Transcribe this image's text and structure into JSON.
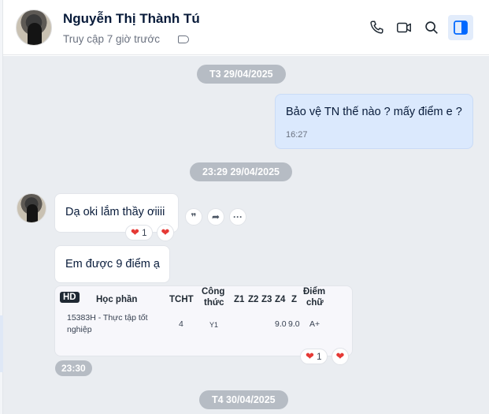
{
  "header": {
    "contact_name": "Nguyễn Thị Thành Tú",
    "status": "Truy cập 7 giờ trước",
    "icons": [
      "phone-icon",
      "video-call-icon",
      "search-icon",
      "side-panel-icon"
    ],
    "accent_color": "#0068ff"
  },
  "chat": {
    "date_separators": [
      "T3 29/04/2025",
      "23:29 29/04/2025",
      "T4 30/04/2025"
    ],
    "outgoing_message": {
      "text": "Bảo vệ TN thế nào ? mấy điểm e ?",
      "time": "16:27"
    },
    "incoming_message_1": {
      "text": "Dạ oki lắm thầy ơiiii",
      "reaction_count": "1"
    },
    "message_actions": {
      "quote": "❞",
      "forward": "➦",
      "more": "···"
    },
    "incoming_message_2": {
      "text": "Em được 9 điểm ạ"
    },
    "grade_card": {
      "badge": "HD",
      "headers": {
        "course": "Học phần",
        "credits": "TCHT",
        "formula_1": "Công",
        "formula_2": "thức",
        "z1": "Z1",
        "z2": "Z2",
        "z3": "Z3",
        "z4": "Z4",
        "z": "Z",
        "letter_1": "Điểm",
        "letter_2": "chữ"
      },
      "row": {
        "course_1": "15383H - Thực tập tốt",
        "course_2": "nghiệp",
        "credits": "4",
        "formula": "Y1",
        "z4": "9.0",
        "z": "9.0",
        "letter": "A+"
      },
      "reaction_count": "1",
      "time": "23:30"
    }
  }
}
